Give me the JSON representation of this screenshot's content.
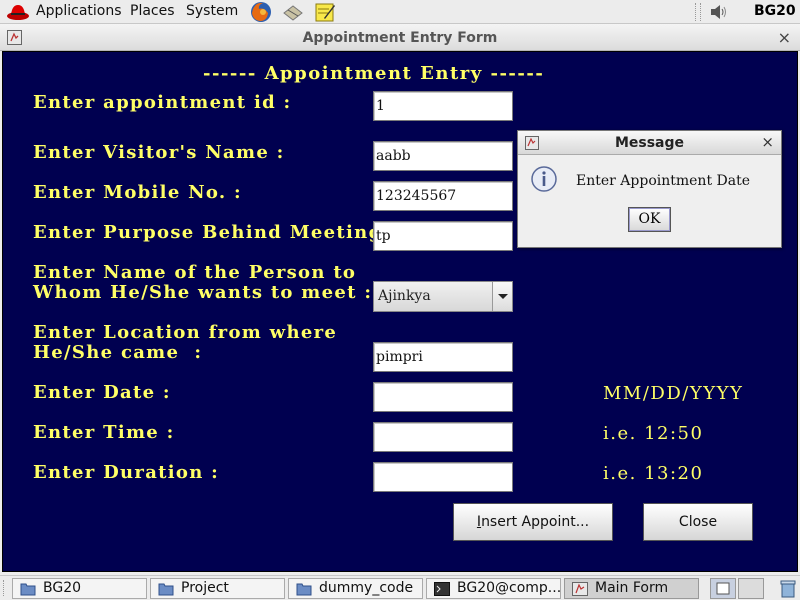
{
  "top_panel": {
    "menus": [
      "Applications",
      "Places",
      "System"
    ],
    "hostname": "BG20"
  },
  "window": {
    "title": "Appointment Entry Form",
    "close_glyph": "×"
  },
  "form": {
    "heading": "------ Appointment Entry ------",
    "labels": {
      "appointment_id": "Enter appointment id :",
      "visitor_name": "Enter Visitor's Name :",
      "mobile": "Enter Mobile No. :",
      "purpose": "Enter Purpose Behind Meeting",
      "person_line1": "Enter Name of the Person to",
      "person_line2": "Whom He/She wants to meet :",
      "location_line1": "Enter Location from where",
      "location_line2": "He/She came  :",
      "date": "Enter Date :",
      "time": "Enter Time :",
      "duration": "Enter Duration :"
    },
    "values": {
      "appointment_id": "1",
      "visitor_name": "aabb",
      "mobile": "123245567",
      "purpose": "tp",
      "person": "Ajinkya",
      "location": "pimpri",
      "date": "",
      "time": "",
      "duration": ""
    },
    "hints": {
      "date": "MM/DD/YYYY",
      "time": "i.e. 12:50",
      "duration": "i.e. 13:20"
    },
    "buttons": {
      "insert": "Insert Appoint...",
      "close": "Close"
    }
  },
  "dialog": {
    "title": "Message",
    "message": "Enter Appointment Date",
    "ok": "OK",
    "close_glyph": "×"
  },
  "taskbar": {
    "items": [
      {
        "label": "BG20",
        "icon": "folder-icon"
      },
      {
        "label": "Project",
        "icon": "folder-icon"
      },
      {
        "label": "dummy_code",
        "icon": "folder-icon"
      },
      {
        "label": "BG20@comp...",
        "icon": "terminal-icon"
      },
      {
        "label": "Main Form",
        "icon": "java-app-icon"
      }
    ]
  },
  "colors": {
    "form_background": "#000050",
    "label_text": "#ffff66"
  }
}
